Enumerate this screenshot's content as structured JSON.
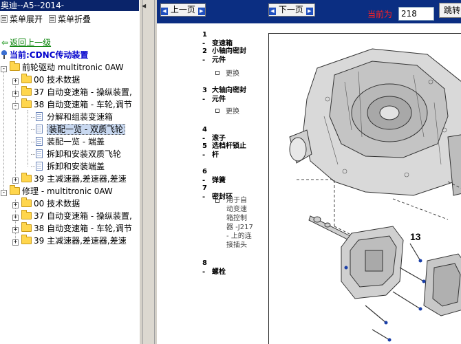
{
  "left": {
    "title": "奥迪--A5--2014-",
    "menu_expand": "菜单展开",
    "menu_collapse": "菜单折叠",
    "back": "返回上一级",
    "current": "当前:CDNC传动装置",
    "tree": {
      "front": "前轮驱动  multitronic 0AW",
      "f00": "00 技术数据",
      "f37": "37 自动变速箱 - 操纵装置,",
      "f38": "38 自动变速箱 - 车轮,调节",
      "f38_items": [
        "分解和组装变速箱",
        "装配一览 - 双质飞轮",
        "装配一览 - 端盖",
        "拆卸和安装双质飞轮",
        "拆卸和安装端盖"
      ],
      "f39": "39 主减速器,差速器,差速",
      "repair": "修理  - multitronic 0AW",
      "r00": "00 技术数据",
      "r37": "37 自动变速箱 - 操纵装置,",
      "r38": "38 自动变速箱 - 车轮,调节",
      "r39": "39 主减速器,差速器,差速"
    }
  },
  "toolbar": {
    "prev": "上一页",
    "next": "下一页",
    "current_label": "当前为",
    "page_value": "218",
    "jump": "跳转"
  },
  "parts": [
    {
      "n": "1 -",
      "text": "变速箱"
    },
    {
      "n": "2 -",
      "text": "小轴向密封\n元件"
    },
    {
      "n": "3 -",
      "text": "大轴向密封\n元件"
    },
    {
      "n": "4 -",
      "text": "滚子"
    },
    {
      "n": "5 -",
      "text": "选档杆锁止\n杆"
    },
    {
      "n": "6 -",
      "text": "弹簧"
    },
    {
      "n": "7 -",
      "text": "密封环"
    },
    {
      "n": "8 -",
      "text": "螺栓"
    }
  ],
  "part_notes": {
    "p2": "更换",
    "p3": "更换",
    "p7": "用于自\n动变速\n箱控制\n器 -J217\n- 上的连\n接插头"
  },
  "diagram": {
    "callout": "13"
  },
  "colors": {
    "toolbar_bg": "#0b2e82",
    "title_bg": "#0a246a",
    "back_link": "#008000",
    "current_text": "#0000cc",
    "current_label": "#ff2020"
  }
}
